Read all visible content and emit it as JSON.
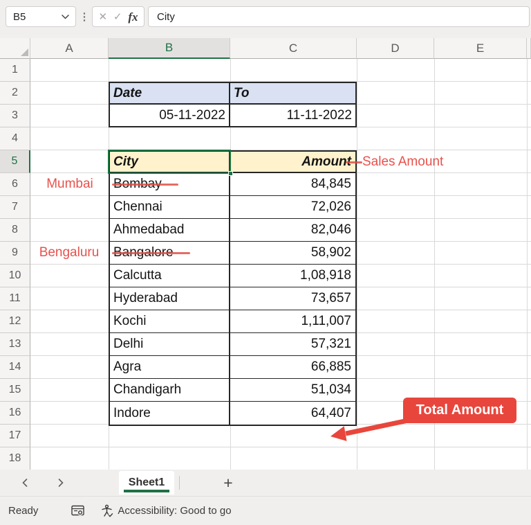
{
  "formula_bar": {
    "name_box": "B5",
    "cancel_glyph": "✕",
    "enter_glyph": "✓",
    "fx_glyph": "fx",
    "dots_glyph": "⋮",
    "formula_value": "City"
  },
  "grid": {
    "columns": [
      "A",
      "B",
      "C",
      "D",
      "E"
    ],
    "rows": [
      "1",
      "2",
      "3",
      "4",
      "5",
      "6",
      "7",
      "8",
      "9",
      "10",
      "11",
      "12",
      "13",
      "14",
      "15",
      "16",
      "17",
      "18"
    ],
    "selected_column": "B",
    "selected_row": "5",
    "selected_cell": "B5"
  },
  "date_table": {
    "headers": [
      "Date",
      "To"
    ],
    "values": [
      "05-11-2022",
      "11-11-2022"
    ]
  },
  "sales_table": {
    "headers": [
      "City",
      "Amount"
    ],
    "rows": [
      {
        "city": "Bombay",
        "amount": "84,845",
        "struck": true
      },
      {
        "city": "Chennai",
        "amount": "72,026",
        "struck": false
      },
      {
        "city": "Ahmedabad",
        "amount": "82,046",
        "struck": false
      },
      {
        "city": "Bangalore",
        "amount": "58,902",
        "struck": true
      },
      {
        "city": "Calcutta",
        "amount": "1,08,918",
        "struck": false
      },
      {
        "city": "Hyderabad",
        "amount": "73,657",
        "struck": false
      },
      {
        "city": "Kochi",
        "amount": "1,11,007",
        "struck": false
      },
      {
        "city": "Delhi",
        "amount": "57,321",
        "struck": false
      },
      {
        "city": "Agra",
        "amount": "66,885",
        "struck": false
      },
      {
        "city": "Chandigarh",
        "amount": "51,034",
        "struck": false
      },
      {
        "city": "Indore",
        "amount": "64,407",
        "struck": false
      }
    ]
  },
  "annotations": {
    "mumbai": "Mumbai",
    "bengaluru": "Bengaluru",
    "sales_amount": "Sales Amount",
    "total_amount": "Total Amount"
  },
  "tabs": {
    "sheet_name": "Sheet1",
    "add_label": "+"
  },
  "status_bar": {
    "ready": "Ready",
    "accessibility": "Accessibility: Good to go"
  },
  "colors": {
    "excel_green": "#1e7145",
    "selection_green": "#1a7340",
    "annotation_red": "#e8514c",
    "callout_red": "#e8463c",
    "date_header_fill": "#d9e1f2",
    "sales_header_fill": "#fff2cc"
  }
}
